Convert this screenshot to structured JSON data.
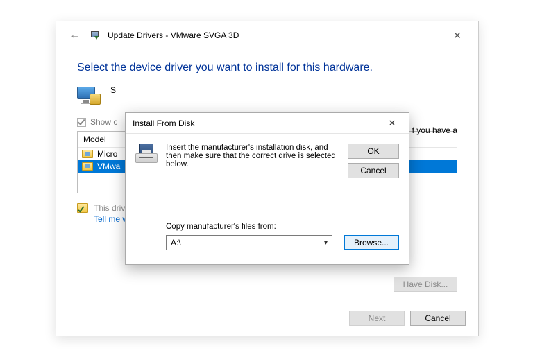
{
  "parent": {
    "title": "Update Drivers - VMware SVGA 3D",
    "heading": "Select the device driver you want to install for this hardware.",
    "instruction_prefix": "S",
    "instruction_trail": "f you have a",
    "show_compatible_prefix": "Show c",
    "model_header": "Model",
    "models": [
      {
        "label_prefix": "Micro"
      },
      {
        "label_prefix": "VMwa"
      }
    ],
    "signed_text": "This driver is digitally signed.",
    "signing_link": "Tell me why driver signing is important",
    "have_disk_label": "Have Disk...",
    "next_label": "Next",
    "cancel_label": "Cancel"
  },
  "dialog": {
    "title": "Install From Disk",
    "message": "Insert the manufacturer's installation disk, and then make sure that the correct drive is selected below.",
    "ok_label": "OK",
    "cancel_label": "Cancel",
    "copy_from_label": "Copy manufacturer's files from:",
    "path_value": "A:\\",
    "browse_label": "Browse..."
  }
}
